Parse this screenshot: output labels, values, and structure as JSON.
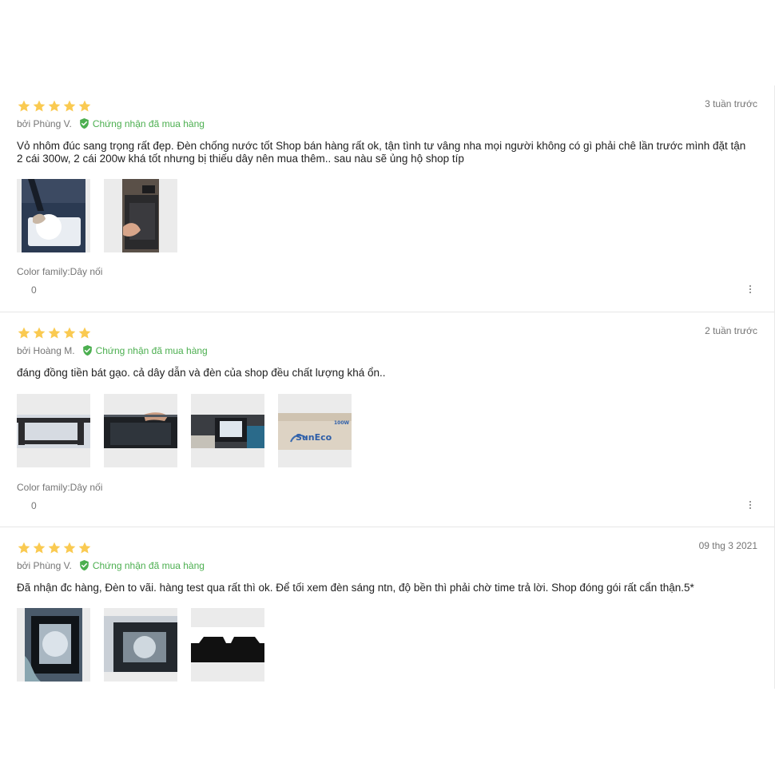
{
  "colors": {
    "star": "#faca51",
    "verified": "#4caf50",
    "muted": "#757575",
    "text": "#212121"
  },
  "reviews": [
    {
      "rating": 5,
      "date": "3 tuần trước",
      "author": "bởi Phùng V.",
      "verified": "Chứng nhận đã mua hàng",
      "content": "Vỏ nhôm đúc sang trọng rất đẹp. Đèn chống nước tốt Shop bán hàng rất ok, tận tình tư vâng nha mọi người không có gì phải chê lần trước mình đặt tận 2 cái 300w, 2 cái 200w khá tốt nhưng bị thiếu dây nên mua thêm.. sau nàu sẽ ủng hộ shop típ",
      "sku": "Color family:Dây nối",
      "likes": "0"
    },
    {
      "rating": 5,
      "date": "2 tuần trước",
      "author": "bởi Hoàng M.",
      "verified": "Chứng nhận đã mua hàng",
      "content": "đáng đồng tiền bát gạo. cả dây dẫn và đèn của shop đều chất lượng khá ổn..",
      "sku": "Color family:Dây nối",
      "likes": "0"
    },
    {
      "rating": 5,
      "date": "09 thg 3 2021",
      "author": "bởi Phùng V.",
      "verified": "Chứng nhận đã mua hàng",
      "content": "Đã nhận đc hàng, Đèn to vãi. hàng test qua rất thì ok. Để tối xem đèn sáng ntn, độ bền thì phải chờ time trả lời. Shop đóng gói rất cẩn thận.5*"
    }
  ],
  "image_labels": {
    "box_brand": "SunEco",
    "box_watt": "100W"
  }
}
